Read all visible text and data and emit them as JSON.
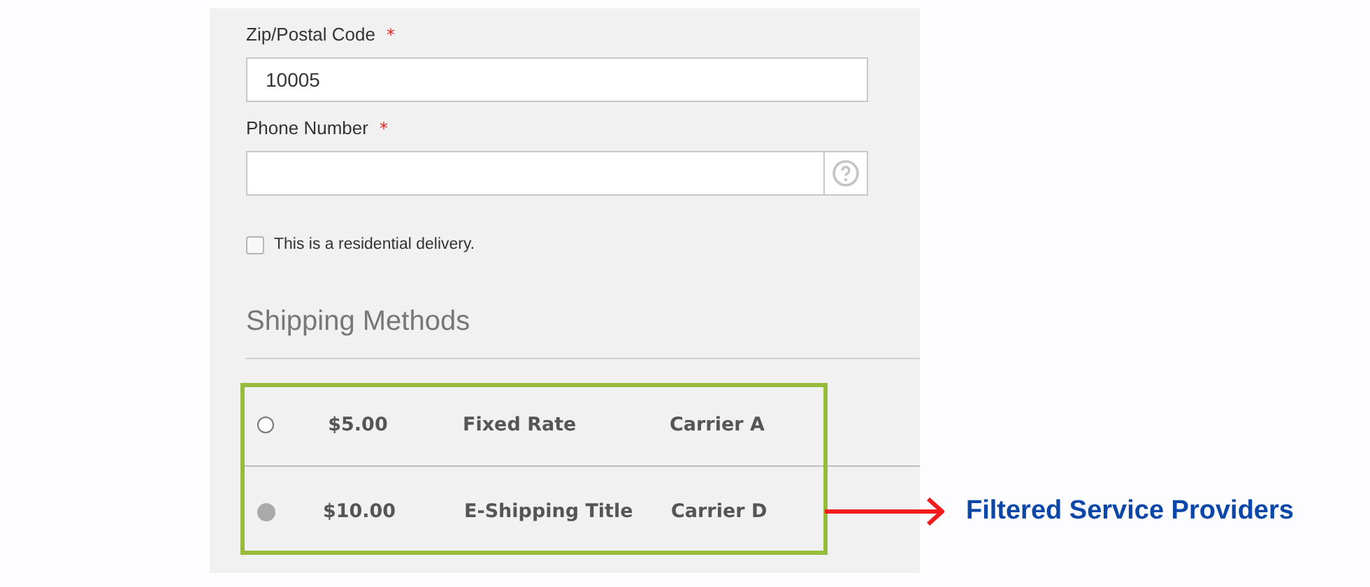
{
  "fields": [
    {
      "label": "Zip/Postal Code",
      "required_mark": "*",
      "value": "10005",
      "kind": "text"
    },
    {
      "label": "Phone Number",
      "required_mark": "*",
      "kind": "help"
    }
  ],
  "residential": {
    "label": "This is a residential delivery.",
    "checked": false
  },
  "shipping": {
    "title": "Shipping Methods",
    "methods": [
      {
        "price": "$5.00",
        "title": "Fixed Rate",
        "carrier": "Carrier A",
        "selected": false
      },
      {
        "price": "$10.00",
        "title": "E-Shipping Title",
        "carrier": "Carrier D",
        "selected": true
      }
    ]
  },
  "callout": {
    "text": "Filtered Service Providers"
  }
}
